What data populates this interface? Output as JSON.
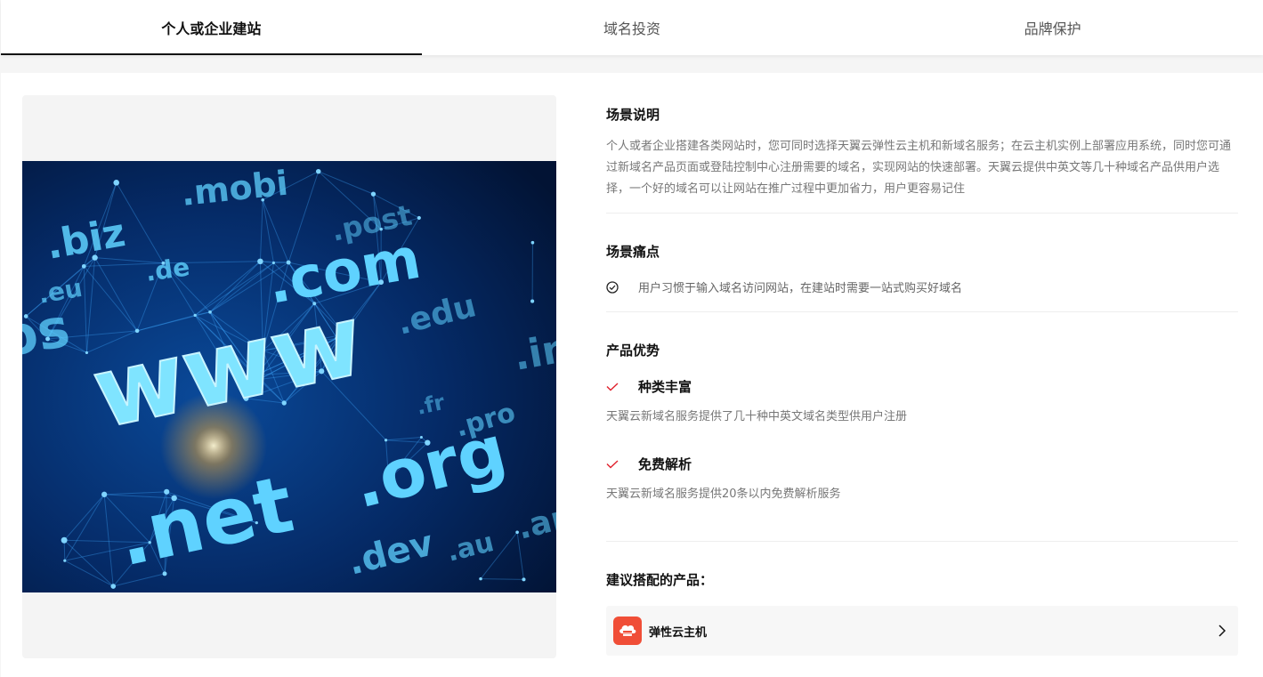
{
  "tabs": [
    {
      "label": "个人或企业建站",
      "active": true
    },
    {
      "label": "域名投资",
      "active": false
    },
    {
      "label": "品牌保护",
      "active": false
    }
  ],
  "image": {
    "words": [
      ".mobi",
      ".biz",
      ".post",
      ".de",
      ".com",
      ".eu",
      ".edu",
      "www",
      ".org",
      ".pro",
      ".net",
      ".dev",
      ".au",
      ".info",
      ".fr",
      "os",
      ".art"
    ]
  },
  "scenario": {
    "title": "场景说明",
    "description": "个人或者企业搭建各类网站时，您可同时选择天翼云弹性云主机和新域名服务；在云主机实例上部署应用系统，同时您可通过新域名产品页面或登陆控制中心注册需要的域名，实现网站的快速部署。天翼云提供中英文等几十种域名产品供用户选择，一个好的域名可以让网站在推广过程中更加省力，用户更容易记住"
  },
  "pain": {
    "title": "场景痛点",
    "items": [
      "用户习惯于输入域名访问网站，在建站时需要一站式购买好域名"
    ]
  },
  "advantages": {
    "title": "产品优势",
    "items": [
      {
        "title": "种类丰富",
        "desc": "天翼云新域名服务提供了几十种中英文域名类型供用户注册"
      },
      {
        "title": "免费解析",
        "desc": "天翼云新域名服务提供20条以内免费解析服务"
      }
    ]
  },
  "recommend": {
    "title": "建议搭配的产品：",
    "products": [
      {
        "name": "弹性云主机"
      }
    ]
  },
  "colors": {
    "accent": "#e0202c",
    "product_icon_bg": "#f04e37"
  }
}
